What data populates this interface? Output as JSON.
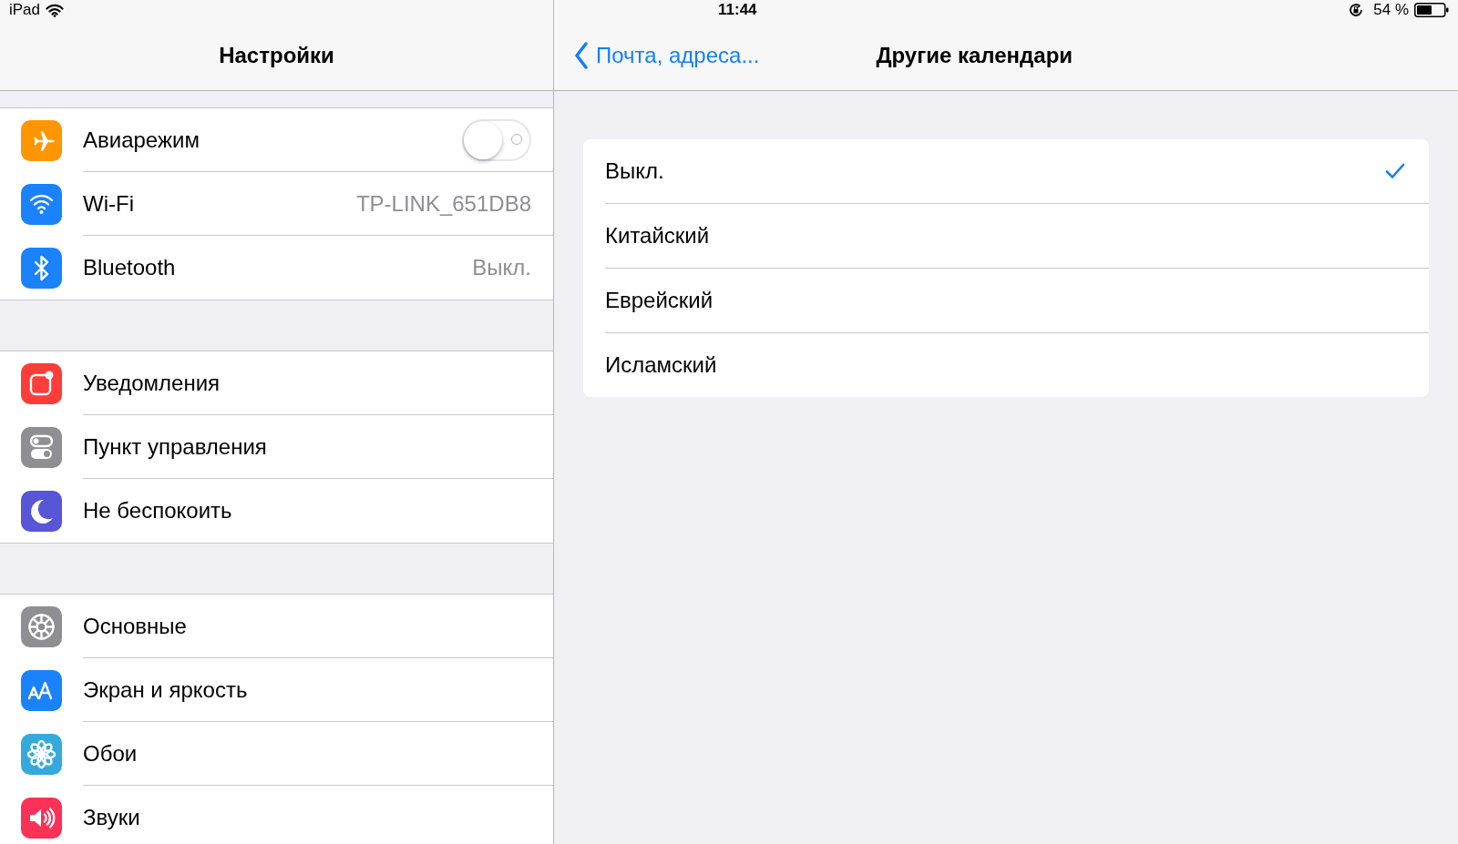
{
  "status_bar": {
    "device": "iPad",
    "time": "11:44",
    "battery_percent": "54 %"
  },
  "sidebar": {
    "title": "Настройки",
    "groups": [
      {
        "items": [
          {
            "label": "Авиарежим",
            "kind": "toggle",
            "on": false,
            "color": "#ff9500"
          },
          {
            "label": "Wi-Fi",
            "kind": "value",
            "value": "TP-LINK_651DB8",
            "color": "#1a82fb"
          },
          {
            "label": "Bluetooth",
            "kind": "value",
            "value": "Выкл.",
            "color": "#1a82fb"
          }
        ]
      },
      {
        "items": [
          {
            "label": "Уведомления",
            "kind": "link",
            "color": "#fc3d39"
          },
          {
            "label": "Пункт управления",
            "kind": "link",
            "color": "#8e8e93"
          },
          {
            "label": "Не беспокоить",
            "kind": "link",
            "color": "#5856d6"
          }
        ]
      },
      {
        "items": [
          {
            "label": "Основные",
            "kind": "link",
            "color": "#8e8e93"
          },
          {
            "label": "Экран и яркость",
            "kind": "link",
            "color": "#1a82fb"
          },
          {
            "label": "Обои",
            "kind": "link",
            "color": "#34aadc"
          },
          {
            "label": "Звуки",
            "kind": "link",
            "color": "#fc3158"
          }
        ]
      }
    ]
  },
  "detail": {
    "back_label": "Почта, адреса...",
    "title": "Другие календари",
    "options": [
      {
        "label": "Выкл.",
        "selected": true
      },
      {
        "label": "Китайский",
        "selected": false
      },
      {
        "label": "Еврейский",
        "selected": false
      },
      {
        "label": "Исламский",
        "selected": false
      }
    ]
  }
}
